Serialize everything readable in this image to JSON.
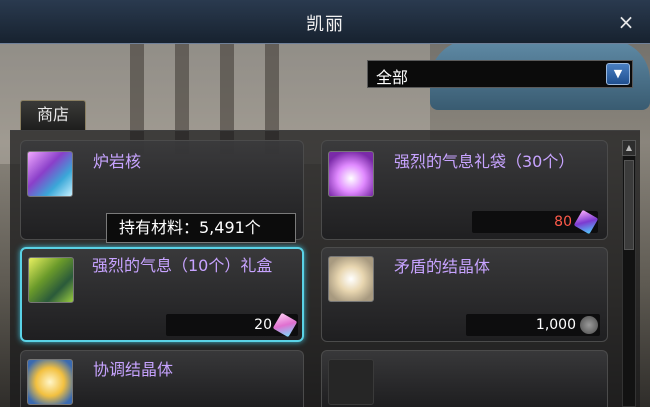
{
  "window": {
    "title": "凯丽",
    "close_label": "×"
  },
  "category": {
    "selected": "全部"
  },
  "tabs": [
    {
      "label": "商店"
    }
  ],
  "tooltip": {
    "text": "持有材料：5,491个"
  },
  "items": [
    {
      "name": "炉岩核",
      "price": "",
      "price_color": "#ffffff",
      "icon": "crystal-core-icon"
    },
    {
      "name": "强烈的气息礼袋（30个）",
      "price": "80",
      "price_color": "#ff5a4a",
      "icon": "gift-bag-icon"
    },
    {
      "name": "强烈的气息（10个）礼盒",
      "price": "20",
      "price_color": "#ffffff",
      "icon": "gift-box-icon"
    },
    {
      "name": "矛盾的结晶体",
      "price": "1,000",
      "price_color": "#ffffff",
      "icon": "contradiction-crystal-icon"
    },
    {
      "name": "协调结晶体",
      "price": "",
      "price_color": "#ffffff",
      "icon": "harmony-crystal-icon"
    }
  ]
}
